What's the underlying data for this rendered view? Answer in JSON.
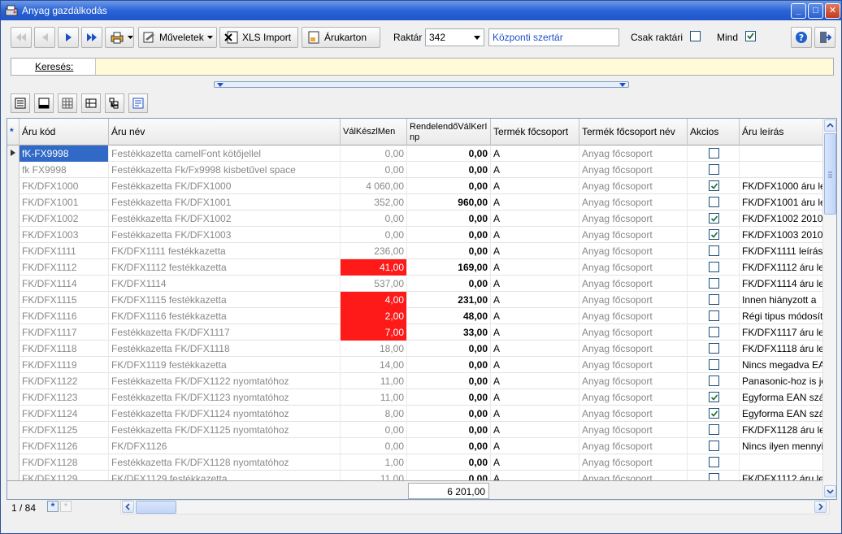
{
  "window": {
    "title": "Anyag gazdálkodás"
  },
  "toolbar": {
    "operations_label": "Műveletek",
    "xls_import_label": "XLS Import",
    "arukarton_label": "Árukarton",
    "raktar_label": "Raktár",
    "raktar_value": "342",
    "raktar_name": "Központi szertár",
    "csak_raktari_label": "Csak raktári",
    "csak_raktari_checked": false,
    "mind_label": "Mind",
    "mind_checked": true
  },
  "search": {
    "label": "Keresés:",
    "value": ""
  },
  "columns": {
    "code": "Áru kód",
    "name": "Áru név",
    "stock": "VálKészlMen",
    "order": "RendelendőVálKerInp",
    "group": "Termék főcsoport",
    "group_name": "Termék főcsoport név",
    "promo": "Akcios",
    "desc": "Áru leírás"
  },
  "rows": [
    {
      "code": "fK-FX9998",
      "name": "Festékkazetta camelFont kötőjellel",
      "stock": "0,00",
      "order": "0,00",
      "group": "A",
      "group_name": "Anyag főcsoport",
      "promo": false,
      "desc": "",
      "red": false,
      "selected": true
    },
    {
      "code": "fk FX9998",
      "name": "Festékkazetta Fk/Fx9998 kisbetűvel space",
      "stock": "0,00",
      "order": "0,00",
      "group": "A",
      "group_name": "Anyag főcsoport",
      "promo": false,
      "desc": "",
      "red": false
    },
    {
      "code": "FK/DFX1000",
      "name": "Festékkazetta FK/DFX1000",
      "stock": "4 060,00",
      "order": "0,00",
      "group": "A",
      "group_name": "Anyag főcsoport",
      "promo": true,
      "desc": "FK/DFX1000 áru le",
      "red": false
    },
    {
      "code": "FK/DFX1001",
      "name": "Festékkazetta FK/DFX1001",
      "stock": "352,00",
      "order": "960,00",
      "group": "A",
      "group_name": "Anyag főcsoport",
      "promo": false,
      "desc": "FK/DFX1001 áru le",
      "red": false
    },
    {
      "code": "FK/DFX1002",
      "name": "Festékkazetta FK/DFX1002",
      "stock": "0,00",
      "order": "0,00",
      "group": "A",
      "group_name": "Anyag főcsoport",
      "promo": true,
      "desc": "FK/DFX1002 2010.",
      "red": false
    },
    {
      "code": "FK/DFX1003",
      "name": "Festékkazetta FK/DFX1003",
      "stock": "0,00",
      "order": "0,00",
      "group": "A",
      "group_name": "Anyag főcsoport",
      "promo": true,
      "desc": "FK/DFX1003 2010.",
      "red": false
    },
    {
      "code": "FK/DFX1111",
      "name": "FK/DFX1111 festékkazetta",
      "stock": "236,00",
      "order": "0,00",
      "group": "A",
      "group_name": "Anyag főcsoport",
      "promo": false,
      "desc": "FK/DFX1111 leírás",
      "red": false
    },
    {
      "code": "FK/DFX1112",
      "name": "FK/DFX1112 festékkazetta",
      "stock": "41,00",
      "order": "169,00",
      "group": "A",
      "group_name": "Anyag főcsoport",
      "promo": false,
      "desc": "FK/DFX1112 áru le",
      "red": true
    },
    {
      "code": "FK/DFX1114",
      "name": "FK/DFX1114",
      "stock": "537,00",
      "order": "0,00",
      "group": "A",
      "group_name": "Anyag főcsoport",
      "promo": false,
      "desc": "FK/DFX1114 áru le",
      "red": false
    },
    {
      "code": "FK/DFX1115",
      "name": "FK/DFX1115 festékkazetta",
      "stock": "4,00",
      "order": "231,00",
      "group": "A",
      "group_name": "Anyag főcsoport",
      "promo": false,
      "desc": "Innen hiányzott a",
      "red": true
    },
    {
      "code": "FK/DFX1116",
      "name": "FK/DFX1116 festékkazetta",
      "stock": "2,00",
      "order": "48,00",
      "group": "A",
      "group_name": "Anyag főcsoport",
      "promo": false,
      "desc": "Régi tipus módosít",
      "red": true
    },
    {
      "code": "FK/DFX1117",
      "name": "Festékkazetta FK/DFX1117",
      "stock": "7,00",
      "order": "33,00",
      "group": "A",
      "group_name": "Anyag főcsoport",
      "promo": false,
      "desc": "FK/DFX1117 áru le",
      "red": true
    },
    {
      "code": "FK/DFX1118",
      "name": "Festékkazetta FK/DFX1118",
      "stock": "18,00",
      "order": "0,00",
      "group": "A",
      "group_name": "Anyag főcsoport",
      "promo": false,
      "desc": "FK/DFX1118 áru le",
      "red": false
    },
    {
      "code": "FK/DFX1119",
      "name": "FK/DFX1119 festékkazetta",
      "stock": "14,00",
      "order": "0,00",
      "group": "A",
      "group_name": "Anyag főcsoport",
      "promo": false,
      "desc": "Nincs megadva EA",
      "red": false
    },
    {
      "code": "FK/DFX1122",
      "name": "Festékkazetta FK/DFX1122 nyomtatóhoz",
      "stock": "11,00",
      "order": "0,00",
      "group": "A",
      "group_name": "Anyag főcsoport",
      "promo": false,
      "desc": "Panasonic-hoz is jó",
      "red": false
    },
    {
      "code": "FK/DFX1123",
      "name": "Festékkazetta FK/DFX1123 nyomtatóhoz",
      "stock": "11,00",
      "order": "0,00",
      "group": "A",
      "group_name": "Anyag főcsoport",
      "promo": true,
      "desc": "Egyforma EAN szár",
      "red": false
    },
    {
      "code": "FK/DFX1124",
      "name": "Festékkazetta FK/DFX1124 nyomtatóhoz",
      "stock": "8,00",
      "order": "0,00",
      "group": "A",
      "group_name": "Anyag főcsoport",
      "promo": true,
      "desc": "Egyforma EAN szár",
      "red": false
    },
    {
      "code": "FK/DFX1125",
      "name": "Festékkazetta FK/DFX1125 nyomtatóhoz",
      "stock": "0,00",
      "order": "0,00",
      "group": "A",
      "group_name": "Anyag főcsoport",
      "promo": false,
      "desc": "FK/DFX1128 áru le",
      "red": false
    },
    {
      "code": "FK/DFX1126",
      "name": "FK/DFX1126",
      "stock": "0,00",
      "order": "0,00",
      "group": "A",
      "group_name": "Anyag főcsoport",
      "promo": false,
      "desc": "Nincs ilyen mennyis",
      "red": false
    },
    {
      "code": "FK/DFX1128",
      "name": "Festékkazetta FK/DFX1128 nyomtatóhoz",
      "stock": "1,00",
      "order": "0,00",
      "group": "A",
      "group_name": "Anyag főcsoport",
      "promo": false,
      "desc": "",
      "red": false
    },
    {
      "code": "FK/DFX1129",
      "name": "FK/DFX1129 festékkazetta",
      "stock": "11,00",
      "order": "0,00",
      "group": "A",
      "group_name": "Anyag főcsoport",
      "promo": false,
      "desc": "FK/DFX1112 áru le",
      "red": false
    }
  ],
  "footer": {
    "order_sum": "6 201,00"
  },
  "status": {
    "record_position": "1 / 84"
  },
  "colors": {
    "title_bar": "#2a64d8",
    "alert_red": "#ff1a1a",
    "selection": "#3169c6",
    "search_bg": "#fffbd6"
  }
}
